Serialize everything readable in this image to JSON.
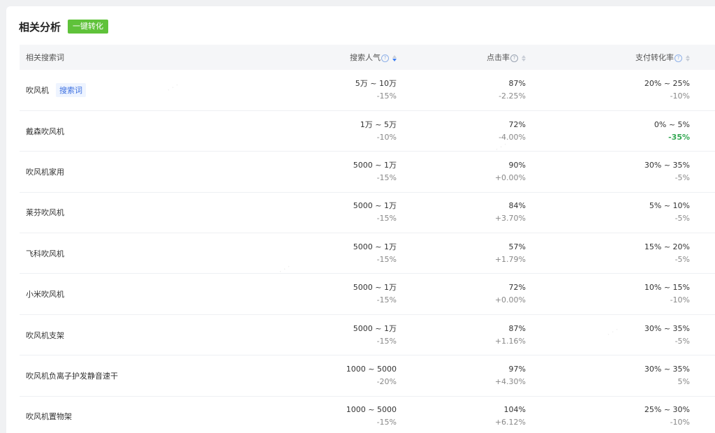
{
  "header": {
    "title": "相关分析",
    "convert_button": "一键转化"
  },
  "table": {
    "columns": {
      "keyword": "相关搜索词",
      "popularity": "搜索人气",
      "click_rate": "点击率",
      "pay_rate": "支付转化率"
    },
    "rows": [
      {
        "keyword": "吹风机",
        "tag": "搜索词",
        "pop": "5万 ~ 10万",
        "pop_change": "-15%",
        "ctr": "87%",
        "ctr_change": "-2.25%",
        "pay": "20% ~ 25%",
        "pay_change": "-10%"
      },
      {
        "keyword": "戴森吹风机",
        "tag": "",
        "pop": "1万 ~ 5万",
        "pop_change": "-10%",
        "ctr": "72%",
        "ctr_change": "-4.00%",
        "pay": "0% ~ 5%",
        "pay_change": "-35%"
      },
      {
        "keyword": "吹风机家用",
        "tag": "",
        "pop": "5000 ~ 1万",
        "pop_change": "-15%",
        "ctr": "90%",
        "ctr_change": "+0.00%",
        "pay": "30% ~ 35%",
        "pay_change": "-5%"
      },
      {
        "keyword": "莱芬吹风机",
        "tag": "",
        "pop": "5000 ~ 1万",
        "pop_change": "-15%",
        "ctr": "84%",
        "ctr_change": "+3.70%",
        "pay": "5% ~ 10%",
        "pay_change": "-5%"
      },
      {
        "keyword": "飞科吹风机",
        "tag": "",
        "pop": "5000 ~ 1万",
        "pop_change": "-15%",
        "ctr": "57%",
        "ctr_change": "+1.79%",
        "pay": "15% ~ 20%",
        "pay_change": "-5%"
      },
      {
        "keyword": "小米吹风机",
        "tag": "",
        "pop": "5000 ~ 1万",
        "pop_change": "-15%",
        "ctr": "72%",
        "ctr_change": "+0.00%",
        "pay": "10% ~ 15%",
        "pay_change": "-10%"
      },
      {
        "keyword": "吹风机支架",
        "tag": "",
        "pop": "5000 ~ 1万",
        "pop_change": "-15%",
        "ctr": "87%",
        "ctr_change": "+1.16%",
        "pay": "30% ~ 35%",
        "pay_change": "-5%"
      },
      {
        "keyword": "吹风机负离子护发静音速干",
        "tag": "",
        "pop": "1000 ~ 5000",
        "pop_change": "-20%",
        "ctr": "97%",
        "ctr_change": "+4.30%",
        "pay": "30% ~ 35%",
        "pay_change": "5%"
      },
      {
        "keyword": "吹风机置物架",
        "tag": "",
        "pop": "1000 ~ 5000",
        "pop_change": "-15%",
        "ctr": "104%",
        "ctr_change": "+6.12%",
        "pay": "25% ~ 30%",
        "pay_change": "-10%"
      }
    ]
  },
  "colors": {
    "button_bg": "#5fc23a",
    "tag_text": "#3c6fe0",
    "sort_active": "#3c7ef3",
    "highlight_green": "#34a853"
  }
}
